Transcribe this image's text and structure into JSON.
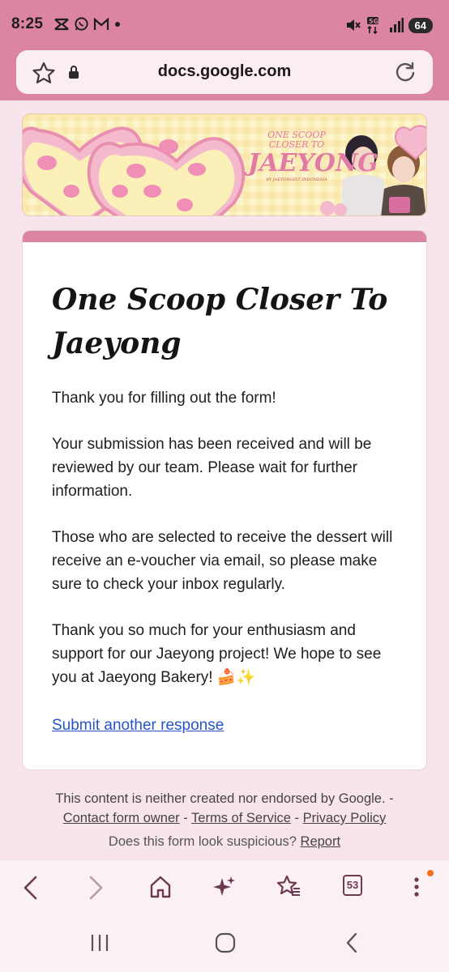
{
  "status_bar": {
    "time": "8:25",
    "battery": "64",
    "left_icons": [
      "capcut-icon",
      "whatsapp-icon",
      "gmail-icon",
      "dot-icon"
    ],
    "right_icons": [
      "mute-icon",
      "5g-data-icon",
      "signal-icon",
      "battery-icon"
    ]
  },
  "browser": {
    "url": "docs.google.com",
    "tab_count": "53"
  },
  "banner": {
    "title_line1": "ONE SCOOP",
    "title_line2": "CLOSER TO",
    "title_big": "JAEYONG",
    "credit": "BY JAEYONGIST INDONESIA"
  },
  "form": {
    "title": "One Scoop Closer To Jaeyong",
    "paragraphs": [
      "Thank you for filling out the form!",
      "Your submission has been received and will be reviewed by our team. Please wait for further information.",
      "Those who are selected to receive the dessert will receive an e-voucher via email, so please make sure to check your inbox regularly.",
      "Thank you so much for your enthusiasm and support for our Jaeyong project! We hope to see you at Jaeyong Bakery! 🍰✨"
    ],
    "submit_another": "Submit another response"
  },
  "footer": {
    "disclaimer": "This content is neither created nor endorsed by Google. -",
    "contact": "Contact form owner",
    "sep1": " - ",
    "terms": "Terms of Service",
    "sep2": " - ",
    "privacy": "Privacy Policy",
    "suspicious": "Does this form look suspicious?",
    "report": "Report"
  },
  "colors": {
    "accent": "#dc84a4",
    "link": "#2554c7",
    "background": "#f8e4ec"
  }
}
